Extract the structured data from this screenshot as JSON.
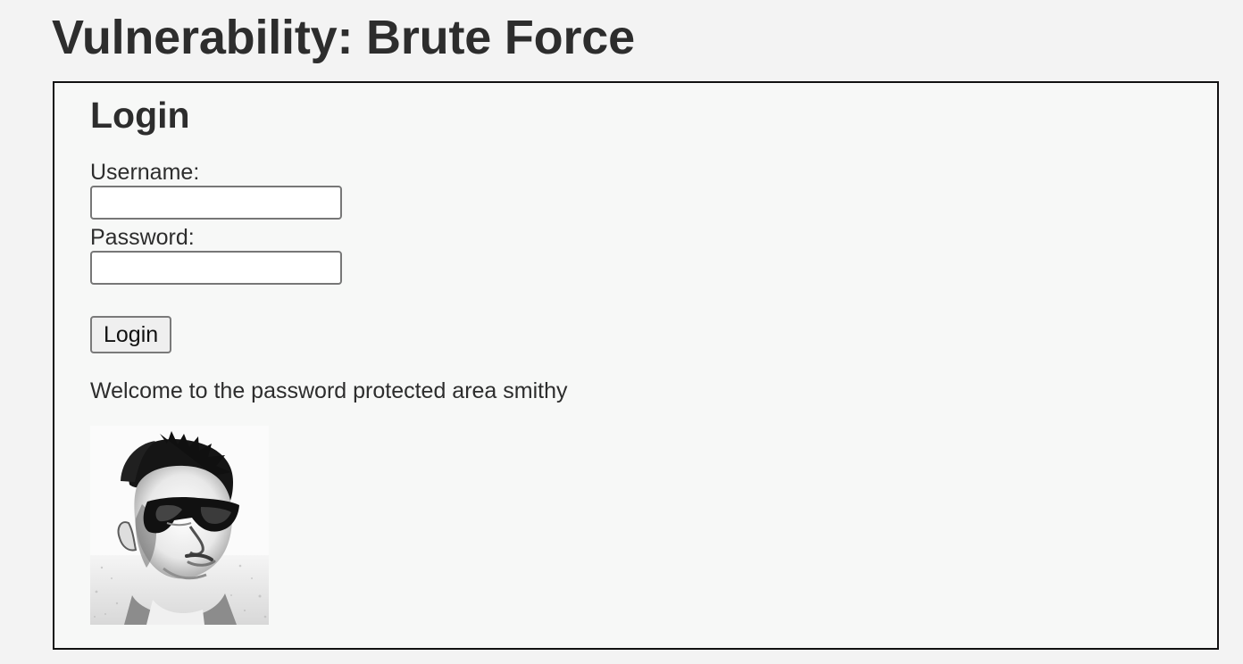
{
  "page": {
    "title": "Vulnerability: Brute Force"
  },
  "login": {
    "heading": "Login",
    "username_label": "Username:",
    "username_value": "",
    "password_label": "Password:",
    "password_value": "",
    "submit_label": "Login",
    "welcome_message": "Welcome to the password protected area smithy"
  },
  "avatar": {
    "icon": "user-photo",
    "style": "black-and-white portrait with sunglasses"
  },
  "colors": {
    "background": "#f3f3f3",
    "panel_background": "#f7f8f7",
    "panel_border": "#111111",
    "text": "#2d2d2d"
  }
}
